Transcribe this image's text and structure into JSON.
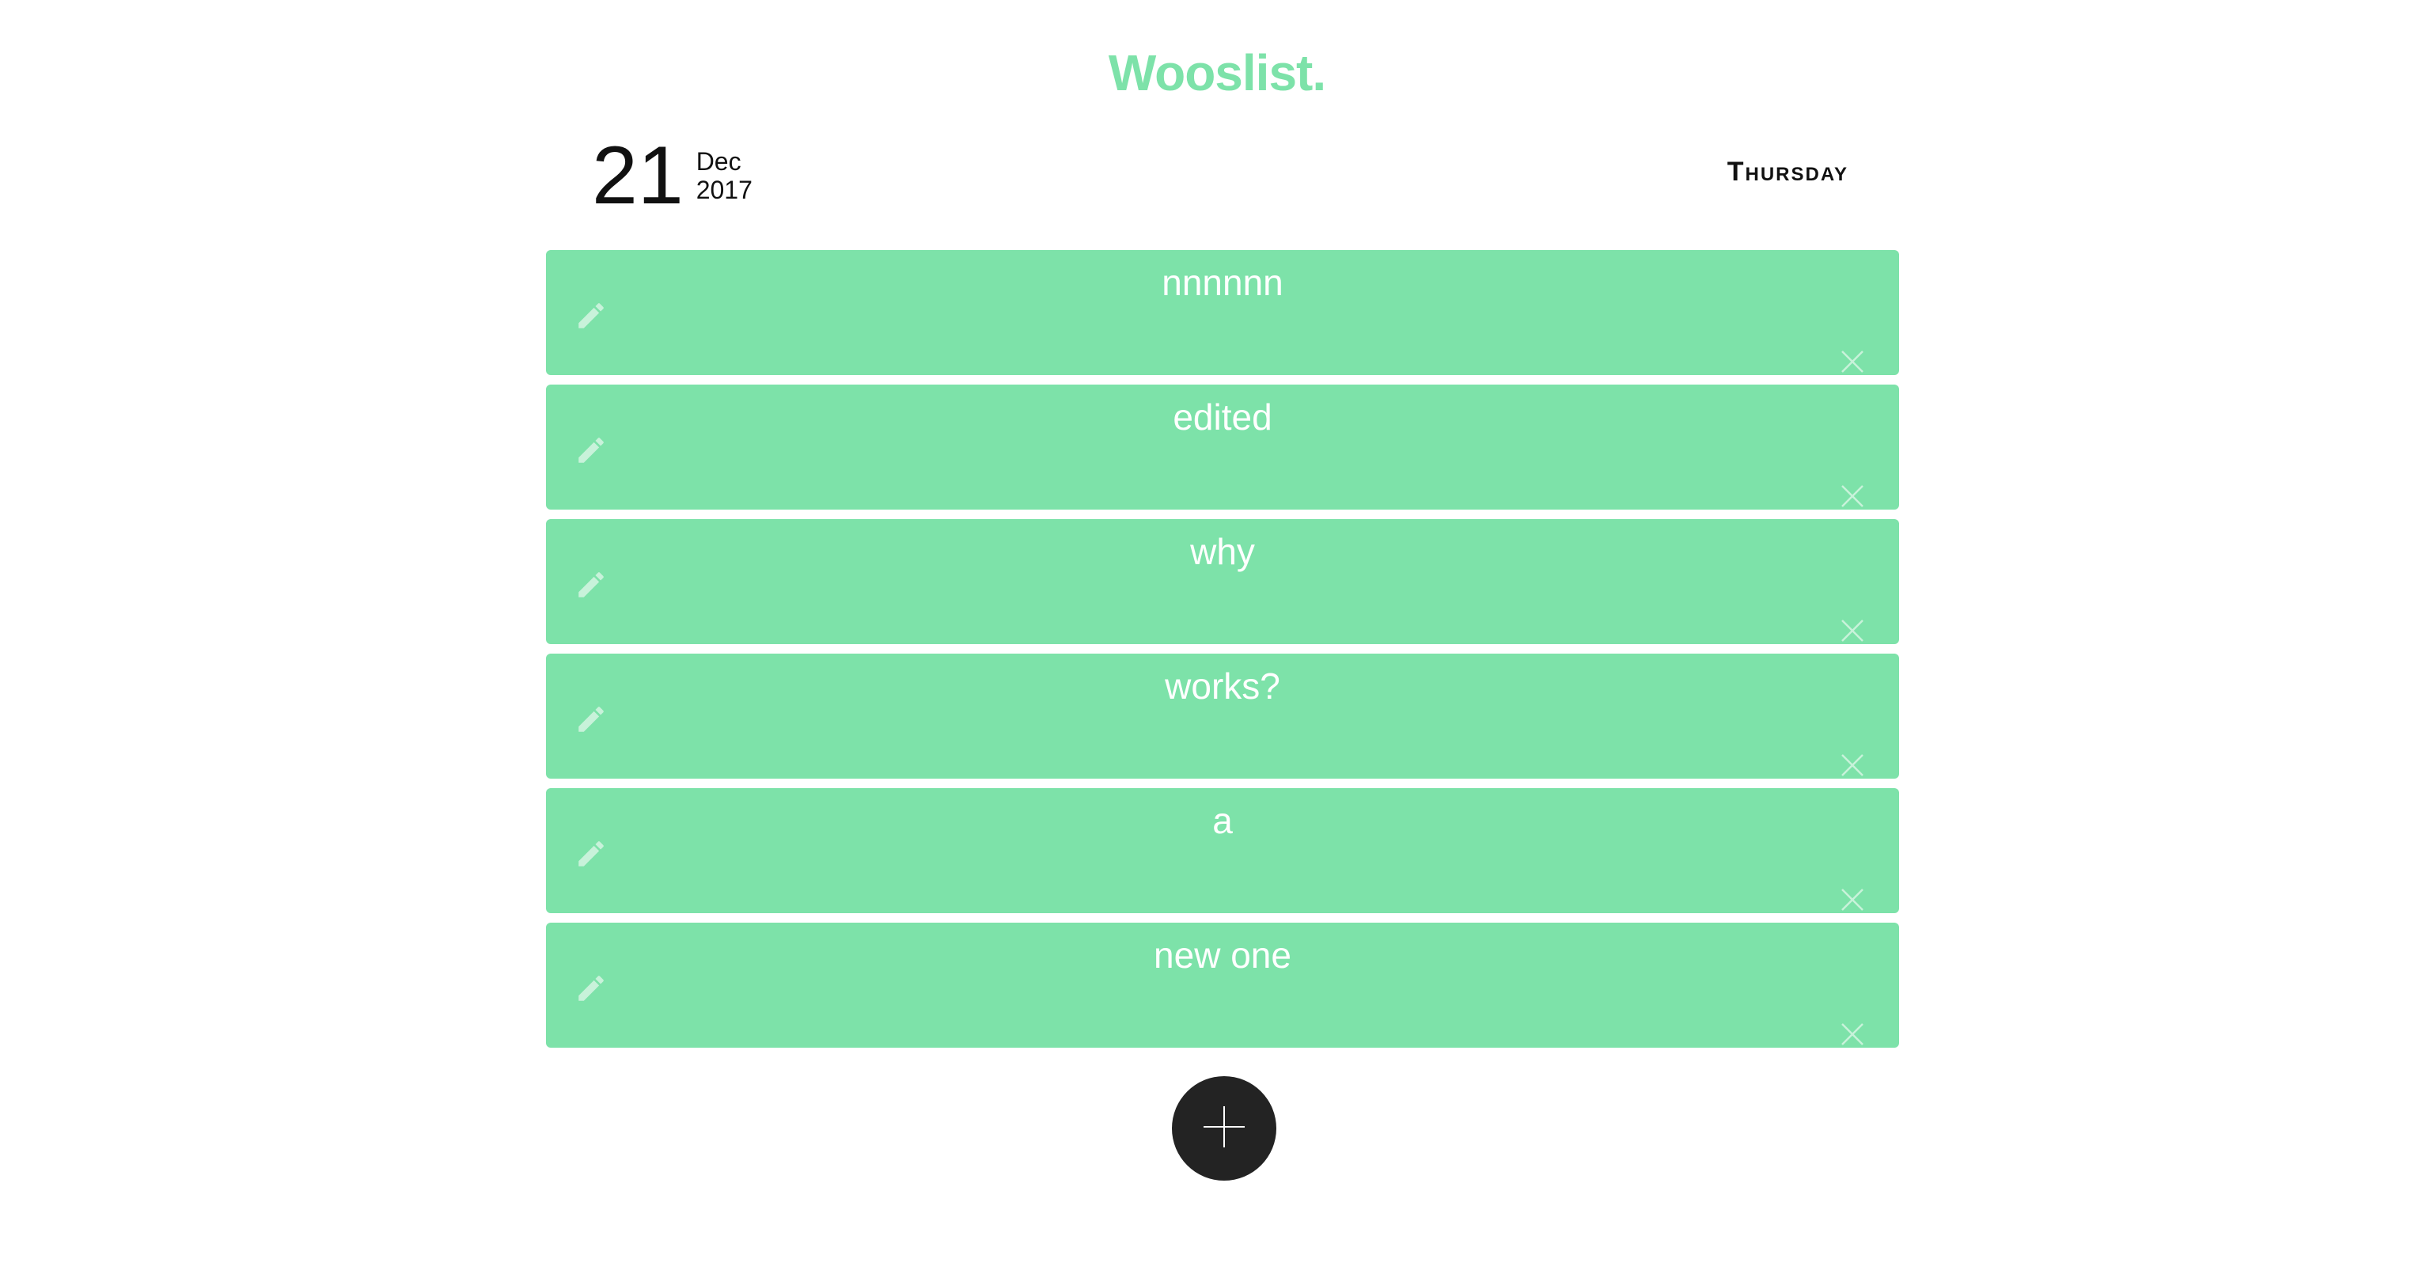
{
  "app": {
    "title": "Wooslist."
  },
  "date": {
    "day": "21",
    "month": "Dec",
    "year": "2017",
    "weekday": "Thursday"
  },
  "todos": [
    {
      "text": "nnnnnn"
    },
    {
      "text": "edited"
    },
    {
      "text": "why"
    },
    {
      "text": "works?"
    },
    {
      "text": "a"
    },
    {
      "text": "new one"
    }
  ],
  "icons": {
    "edit": "pencil-icon",
    "delete": "close-icon",
    "add": "plus-icon"
  },
  "colors": {
    "accent": "#7de2a9",
    "button": "#232323",
    "text": "#111111"
  }
}
